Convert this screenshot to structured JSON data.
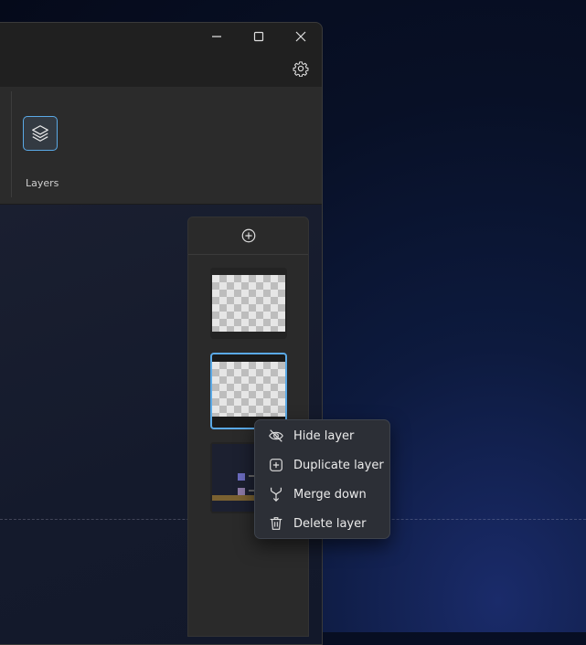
{
  "ribbon": {
    "layers_label": "Layers"
  },
  "icons": {
    "minimize": "minimize-icon",
    "maximize": "maximize-icon",
    "close": "close-icon",
    "settings": "gear-icon",
    "layers": "layers-icon",
    "add": "add-circle-icon"
  },
  "context_menu": {
    "items": [
      {
        "label": "Hide layer",
        "icon": "eye-off-icon"
      },
      {
        "label": "Duplicate layer",
        "icon": "duplicate-icon"
      },
      {
        "label": "Merge down",
        "icon": "merge-down-icon"
      },
      {
        "label": "Delete layer",
        "icon": "trash-icon"
      }
    ]
  },
  "colors": {
    "accent": "#5aa9e6",
    "window_bg": "#202020",
    "ribbon_bg": "#2b2b2b",
    "menu_bg": "#2c2f36"
  }
}
